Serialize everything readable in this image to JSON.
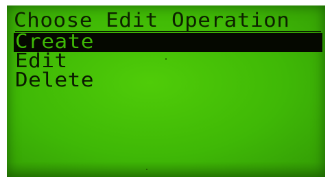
{
  "screen": {
    "title": "Choose Edit Operation",
    "colors": {
      "lcd_background": "#3fb806",
      "lcd_pixel_dark": "#0a1a00",
      "selection_bar": "#050800"
    }
  },
  "menu": {
    "items": [
      {
        "label": "Create",
        "selected": true
      },
      {
        "label": "Edit",
        "selected": false
      },
      {
        "label": "Delete",
        "selected": false
      }
    ]
  }
}
